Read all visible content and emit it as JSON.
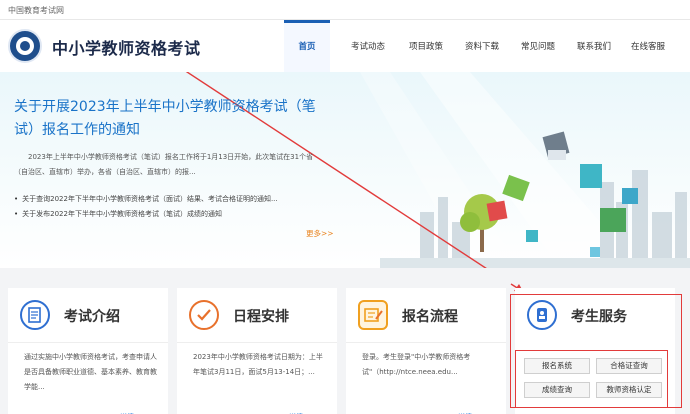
{
  "topbar": {
    "text": "中国教育考试网"
  },
  "header": {
    "site_title": "中小学教师资格考试"
  },
  "nav": [
    {
      "label": "首页",
      "active": true
    },
    {
      "label": "考试动态"
    },
    {
      "label": "项目政策"
    },
    {
      "label": "资料下载"
    },
    {
      "label": "常见问题"
    },
    {
      "label": "联系我们"
    },
    {
      "label": "在线客服"
    }
  ],
  "banner": {
    "title": "关于开展2023年上半年中小学教师资格考试（笔试）报名工作的通知",
    "desc": "2023年上半年中小学教师资格考试（笔试）报名工作将于1月13日开始，此次笔试在31个省（自治区、直辖市）举办，各省（自治区、直辖市）的报...",
    "items": [
      "关于查询2022年下半年中小学教师资格考试（面试）结果、考试合格证明的通知...",
      "关于发布2022年下半年中小学教师资格考试（笔试）成绩的通知"
    ],
    "more": "更多>>"
  },
  "cards": [
    {
      "title": "考试介绍",
      "text": "通过实施中小学教师资格考试，考查申请人是否具备教师职业道德、基本素养、教育教学能...",
      "more": "详情",
      "icon": "notepad-icon",
      "color": "#2f6fd1"
    },
    {
      "title": "日程安排",
      "text": "2023年中小学教师资格考试日期为：上半年笔试3月11日，面试5月13-14日；...",
      "more": "详情",
      "icon": "check-icon",
      "color": "#e8712c"
    },
    {
      "title": "报名流程",
      "text": "登录。考生登录\"中小学教师资格考试\"（http://ntce.neea.edu...",
      "more": "详情",
      "icon": "form-icon",
      "color": "#f0a020"
    }
  ],
  "service": {
    "title": "考生服务",
    "icon": "id-card-icon",
    "buttons": [
      {
        "label": "报名系统"
      },
      {
        "label": "合格证查询"
      },
      {
        "label": "成绩查询"
      },
      {
        "label": "教师资格认定"
      }
    ],
    "annotation_color": "#e23b3b"
  }
}
